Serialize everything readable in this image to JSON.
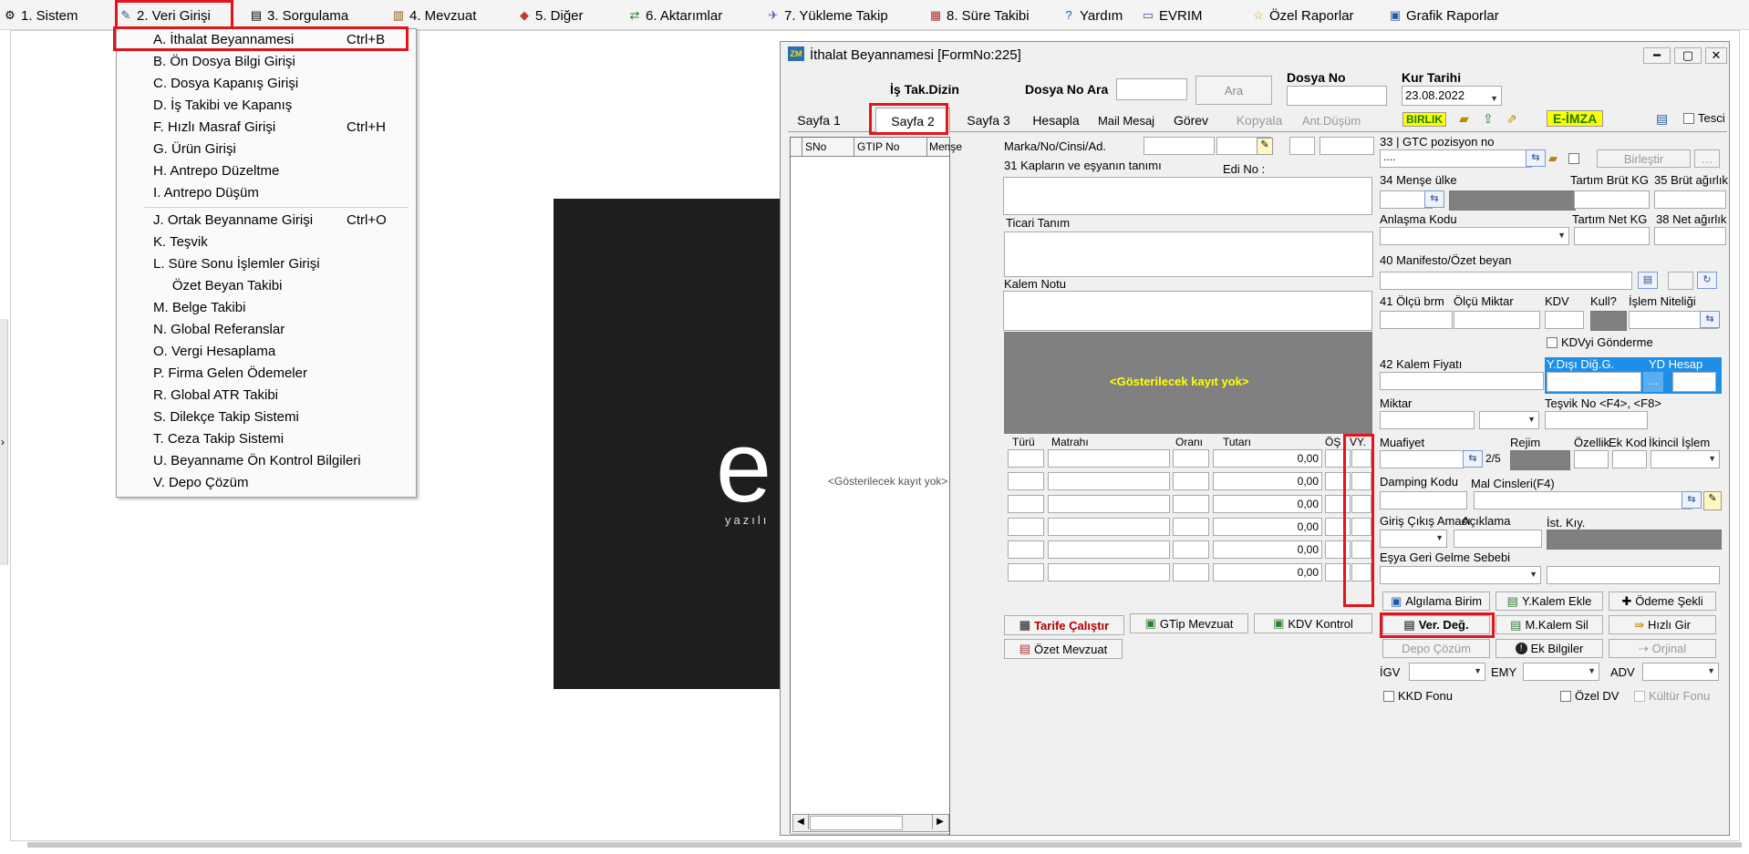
{
  "menubar": {
    "items": [
      {
        "label": "1.  Sistem",
        "icon": "gear-icon"
      },
      {
        "label": "2.  Veri Girişi",
        "icon": "edit-icon"
      },
      {
        "label": "3.  Sorgulama",
        "icon": "query-icon"
      },
      {
        "label": "4.  Mevzuat",
        "icon": "books-icon"
      },
      {
        "label": "5.  Diğer",
        "icon": "shapes-icon"
      },
      {
        "label": "6.  Aktarımlar",
        "icon": "transfer-icon"
      },
      {
        "label": "7.  Yükleme Takip",
        "icon": "truck-icon"
      },
      {
        "label": "8. Süre Takibi",
        "icon": "calendar-icon"
      },
      {
        "label": "Yardım",
        "icon": "help-icon"
      },
      {
        "label": "EVRIM",
        "icon": "evrim-icon"
      },
      {
        "label": "Özel Raporlar",
        "icon": "star-icon"
      },
      {
        "label": "Grafik Raporlar",
        "icon": "chart-icon"
      }
    ]
  },
  "dropdown": {
    "items": [
      {
        "label": "A.  İthalat Beyannamesi",
        "shortcut": "Ctrl+B"
      },
      {
        "label": "B.  Ön Dosya Bilgi Girişi",
        "shortcut": ""
      },
      {
        "label": "C.  Dosya Kapanış Girişi",
        "shortcut": ""
      },
      {
        "label": "D.  İş Takibi ve Kapanış",
        "shortcut": ""
      },
      {
        "label": "F.  Hızlı Masraf Girişi",
        "shortcut": "Ctrl+H"
      },
      {
        "label": "G.  Ürün Girişi",
        "shortcut": ""
      },
      {
        "label": "H.  Antrepo Düzeltme",
        "shortcut": ""
      },
      {
        "label": "I.   Antrepo Düşüm",
        "shortcut": ""
      },
      {
        "label": "J.  Ortak Beyanname Girişi",
        "shortcut": "Ctrl+O"
      },
      {
        "label": "K.  Teşvik",
        "shortcut": ""
      },
      {
        "label": "L.  Süre Sonu İşlemler Girişi",
        "shortcut": ""
      },
      {
        "label": "     Özet Beyan Takibi",
        "shortcut": ""
      },
      {
        "label": "M.  Belge Takibi",
        "shortcut": ""
      },
      {
        "label": "N.  Global Referanslar",
        "shortcut": ""
      },
      {
        "label": "O. Vergi Hesaplama",
        "shortcut": ""
      },
      {
        "label": "P. Firma Gelen Ödemeler",
        "shortcut": ""
      },
      {
        "label": "R. Global ATR Takibi",
        "shortcut": ""
      },
      {
        "label": "S. Dilekçe Takip Sistemi",
        "shortcut": ""
      },
      {
        "label": "T. Ceza Takip Sistemi",
        "shortcut": ""
      },
      {
        "label": "U. Beyanname Ön Kontrol Bilgileri",
        "shortcut": ""
      },
      {
        "label": "V. Depo Çözüm",
        "shortcut": ""
      }
    ]
  },
  "background": {
    "logo_text": "e",
    "tagline": "yazılı"
  },
  "window": {
    "title": "İthalat Beyannamesi [FormNo:225]",
    "header": {
      "is_tak_dizin": "İş Tak.Dizin",
      "dosya_no_ara": "Dosya No Ara",
      "ara_button": "Ara",
      "dosya_no": "Dosya No",
      "kur_tarihi": "Kur Tarihi",
      "kur_tarihi_value": "23.08.2022"
    },
    "tabs": [
      "Sayfa 1",
      "Sayfa 2",
      "Sayfa 3",
      "Hesapla",
      "Mail Mesaj",
      "Görev",
      "Kopyala",
      "Ant.Düşüm"
    ],
    "toolbar": {
      "birlik": "BIRLIK",
      "eimza": "E-İMZA",
      "tescil": "Tesci"
    },
    "grid": {
      "columns": [
        "SNo",
        "GTIP No",
        "Menşe"
      ],
      "empty": "<Gösterilecek kayıt yok>"
    },
    "mid": {
      "marka": "Marka/No/Cinsi/Ad.",
      "kaplar": "31 Kapların ve eşyanın tanımı",
      "edi_no": "Edi No :",
      "ticari_tanim": "Ticari Tanım",
      "kalem_notu": "Kalem Notu",
      "empty": "<Gösterilecek kayıt yok>",
      "tax_cols": [
        "Türü",
        "Matrahı",
        "Oranı",
        "Tutarı",
        "ÖŞ",
        "VY."
      ],
      "tax_values": [
        "0,00",
        "0,00",
        "0,00",
        "0,00",
        "0,00",
        "0,00"
      ],
      "tarife": "Tarife Çalıştır",
      "gtip_mevzuat": "GTip Mevzuat",
      "kdv_kontrol": "KDV Kontrol",
      "ozet_mevzuat": "Özet Mevzuat"
    },
    "right": {
      "gtc": "33 | GTC pozisyon no",
      "gtc_value": "....",
      "birlestir": "Birleştir",
      "mense_ulke": "34 Menşe ülke",
      "tartim_brut": "Tartım Brüt KG",
      "brut_agirlik": "35 Brüt ağırlık",
      "anlasma": "Anlaşma Kodu",
      "tartim_net": "Tartım Net KG",
      "net_agirlik": "38 Net ağırlık",
      "manifesto": "40 Manifesto/Özet beyan",
      "olcu_brm": "41 Ölçü brm",
      "olcu_miktar": "Ölçü Miktar",
      "kdv": "KDV",
      "kull": "Kull?",
      "islem_niteligi": "İşlem Niteliği",
      "kdv_gonderme": "KDVyi Gönderme",
      "kalem_fiyati": "42 Kalem Fiyatı",
      "ydisi": "Y.Dışı Diğ.G.",
      "yd_hesap": "YD Hesap",
      "miktar": "Miktar",
      "tesvik": "Teşvik No <F4>, <F8>",
      "muafiyet": "Muafiyet",
      "muafiyet_count": "2/5",
      "rejim": "Rejim",
      "ozellik": "Özellik",
      "ek_kod": "Ek Kod",
      "ikincil": "İkincil İşlem",
      "damping": "Damping Kodu",
      "mal_cinsleri": "Mal Cinsleri(F4)",
      "giris_cikis": "Giriş Çıkış Amacı",
      "aciklama": "Açıklama",
      "ist_kiy": "İst. Kıy.",
      "esya_geri": "Eşya Geri Gelme Sebebi",
      "algilama": "Algılama Birim",
      "kalem_ekle": "Y.Kalem Ekle",
      "odeme_sekli": "Ödeme Şekli",
      "ver_deg": "Ver. Değ.",
      "kalem_sil": "M.Kalem Sil",
      "hizli_gir": "Hızlı Gir",
      "depo_cozum": "Depo Çözüm",
      "ek_bilgiler": "Ek Bilgiler",
      "orjinal": "Orjinal",
      "igv": "İGV",
      "emy": "EMY",
      "adv": "ADV",
      "kkd_fonu": "KKD Fonu",
      "ozel_dv": "Özel DV",
      "kultur_fonu": "Kültür Fonu"
    }
  }
}
